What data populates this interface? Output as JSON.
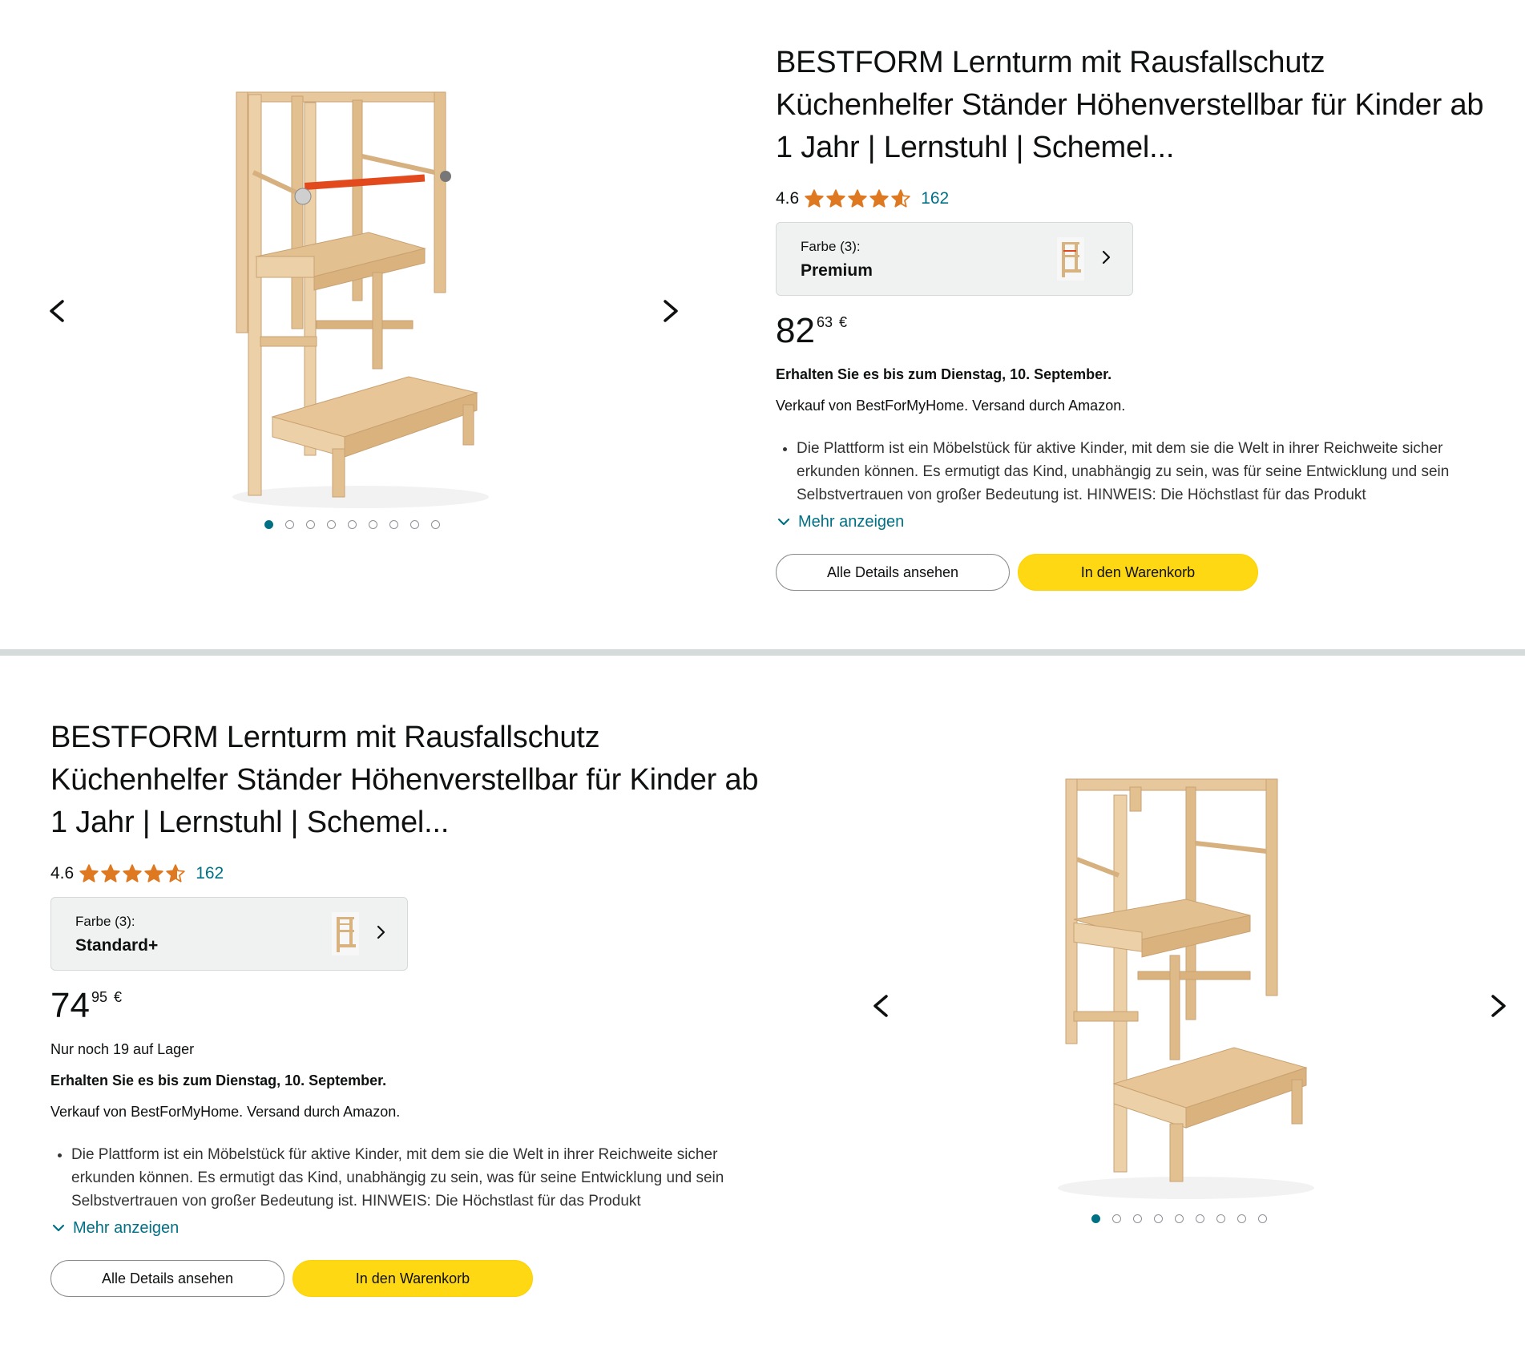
{
  "products": [
    {
      "title": "BESTFORM Lernturm mit Rausfallschutz Küchenhelfer Ständer Höhenverstellbar für Kinder ab 1 Jahr | Lernstuhl | Schemel...",
      "rating": "4.6",
      "rating_value": 4.6,
      "rating_count": "162",
      "variant_label": "Farbe (3):",
      "variant_value": "Premium",
      "price_whole": "82",
      "price_fraction": "63",
      "price_currency": "€",
      "delivery": "Erhalten Sie es bis zum Dienstag, 10. September.",
      "seller": "Verkauf von BestForMyHome. Versand durch Amazon.",
      "bullet": "Die Plattform ist ein Möbelstück für aktive Kinder, mit dem sie die Welt in ihrer Reichweite sicher erkunden können. Es ermutigt das Kind, unabhängig zu sein, was für seine Entwicklung und sein Selbstvertrauen von großer Bedeutung ist. HINWEIS: Die Höchstlast für das Produkt",
      "more_label": "Mehr anzeigen",
      "details_button": "Alle Details ansehen",
      "cart_button": "In den Warenkorb",
      "image_count": 9,
      "active_image": 1
    },
    {
      "title": "BESTFORM Lernturm mit Rausfallschutz Küchenhelfer Ständer Höhenverstellbar für Kinder ab 1 Jahr | Lernstuhl | Schemel...",
      "rating": "4.6",
      "rating_value": 4.6,
      "rating_count": "162",
      "variant_label": "Farbe (3):",
      "variant_value": "Standard+",
      "price_whole": "74",
      "price_fraction": "95",
      "price_currency": "€",
      "stock": "Nur noch 19 auf Lager",
      "delivery": "Erhalten Sie es bis zum Dienstag, 10. September.",
      "seller": "Verkauf von BestForMyHome. Versand durch Amazon.",
      "bullet": "Die Plattform ist ein Möbelstück für aktive Kinder, mit dem sie die Welt in ihrer Reichweite sicher erkunden können. Es ermutigt das Kind, unabhängig zu sein, was für seine Entwicklung und sein Selbstvertrauen von großer Bedeutung ist. HINWEIS: Die Höchstlast für das Produkt",
      "more_label": "Mehr anzeigen",
      "details_button": "Alle Details ansehen",
      "cart_button": "In den Warenkorb",
      "image_count": 9,
      "active_image": 1
    }
  ],
  "colors": {
    "link": "#007185",
    "star": "#de7921",
    "cart_button": "#ffd814",
    "variant_bg": "#f0f2f2",
    "divider": "#d5dbdb",
    "wood": "#e9c9a0"
  },
  "icons": {
    "prev": "chevron-left-icon",
    "next": "chevron-right-icon",
    "more": "chevron-down-icon",
    "star": "star-icon"
  }
}
